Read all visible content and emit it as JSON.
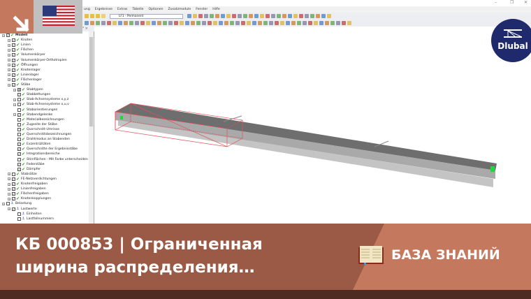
{
  "app": {
    "menu": [
      "ung",
      "Ergebnisse",
      "Extras",
      "Tabelle",
      "Optionen",
      "Zusatzmodule",
      "Fenster",
      "Hilfe"
    ],
    "loadcase_combo": "LF1 - Permanent",
    "panel_controls": "⁴ ×",
    "window_controls": [
      "–",
      "❐",
      "✕"
    ]
  },
  "navigator": {
    "items": [
      {
        "l": 0,
        "t": "Modell",
        "c": "x",
        "i": "check",
        "bold": true
      },
      {
        "l": 1,
        "t": "Knoten",
        "c": "x",
        "i": "check"
      },
      {
        "l": 1,
        "t": "Linien",
        "c": "x",
        "i": "check"
      },
      {
        "l": 1,
        "t": "Flächen",
        "c": "x",
        "i": "check"
      },
      {
        "l": 1,
        "t": "Volumenkörper",
        "c": "x",
        "i": "check"
      },
      {
        "l": 1,
        "t": "Volumenkörper-Orthotropien",
        "c": "x",
        "i": "check"
      },
      {
        "l": 1,
        "t": "Öffnungen",
        "c": "x",
        "i": "check"
      },
      {
        "l": 1,
        "t": "Knotenlager",
        "c": "x",
        "i": "check"
      },
      {
        "l": 1,
        "t": "Linienlager",
        "c": "x",
        "i": "check"
      },
      {
        "l": 1,
        "t": "Flächenlager",
        "c": "x",
        "i": "check"
      },
      {
        "l": 1,
        "t": "Stäbe",
        "c": "x",
        "i": "check"
      },
      {
        "l": 2,
        "t": "Stabtypen",
        "c": "p",
        "i": "check"
      },
      {
        "l": 2,
        "t": "Stabbettungen",
        "c": "x",
        "i": "check"
      },
      {
        "l": 2,
        "t": "Stab-Achsensysteme x,y,z",
        "c": "",
        "i": "check"
      },
      {
        "l": 2,
        "t": "Stab-Achsensysteme x,u,v",
        "c": "",
        "i": "check"
      },
      {
        "l": 2,
        "t": "Staborientierungen",
        "c": "",
        "i": "check"
      },
      {
        "l": 2,
        "t": "Stabendgelenke",
        "c": "x",
        "i": "check"
      },
      {
        "l": 2,
        "t": "Materialbezeichnungen",
        "c": "",
        "i": "check"
      },
      {
        "l": 2,
        "t": "Zugseite der Stäbe",
        "c": "",
        "i": "check"
      },
      {
        "l": 2,
        "t": "Querschnitt-Umrisse",
        "c": "",
        "i": "check"
      },
      {
        "l": 2,
        "t": "Querschnittsbezeichnungen",
        "c": "",
        "i": "check"
      },
      {
        "l": 2,
        "t": "Drahtmodus an Stabenden",
        "c": "",
        "i": "check"
      },
      {
        "l": 2,
        "t": "Exzentrizitäten",
        "c": "x",
        "i": "check"
      },
      {
        "l": 2,
        "t": "Querschnitte der Ergebnisstäbe",
        "c": "x",
        "i": "check"
      },
      {
        "l": 2,
        "t": "Integrationsbereiche",
        "c": "x",
        "i": "check"
      },
      {
        "l": 2,
        "t": "Stirnflächen - Mit Farbe unterscheiden",
        "c": "",
        "i": "check"
      },
      {
        "l": 2,
        "t": "Federstäbe",
        "c": "x",
        "i": "check"
      },
      {
        "l": 2,
        "t": "Dämpfer",
        "c": "x",
        "i": "check"
      },
      {
        "l": 1,
        "t": "Stabsätze",
        "c": "",
        "i": "check"
      },
      {
        "l": 1,
        "t": "FE-Netzverdichtungen",
        "c": "x",
        "i": "check"
      },
      {
        "l": 1,
        "t": "Knotenfreigaben",
        "c": "x",
        "i": "check"
      },
      {
        "l": 1,
        "t": "Linienfreigaben",
        "c": "x",
        "i": "check"
      },
      {
        "l": 1,
        "t": "Flächenfreigaben",
        "c": "x",
        "i": "check"
      },
      {
        "l": 1,
        "t": "Knotenkopplungen",
        "c": "x",
        "i": "check"
      },
      {
        "l": 0,
        "t": "Belastung",
        "c": "",
        "i": "load"
      },
      {
        "l": 1,
        "t": "Lastwerte",
        "c": "x",
        "i": "load"
      },
      {
        "l": 2,
        "t": "Einheiten",
        "c": "",
        "i": "load"
      },
      {
        "l": 2,
        "t": "Lastfallnummern",
        "c": "",
        "i": "load"
      }
    ]
  },
  "logo": {
    "text": "Dlubal",
    "color": "#1f2a6c"
  },
  "banner": {
    "line1": "КБ 000853 | Ограниченная",
    "line2": "ширина распределения…",
    "knowledge_base": "БАЗА ЗНАНИЙ",
    "colors": {
      "light": "#c4785e",
      "dark": "#9a5a45",
      "bottom": "#4e2c22"
    }
  },
  "colors": {
    "beam_top": "#6e6e6e",
    "beam_side": "#b4b4b4",
    "load_box": "#e0505a",
    "support": "#22d83a"
  }
}
